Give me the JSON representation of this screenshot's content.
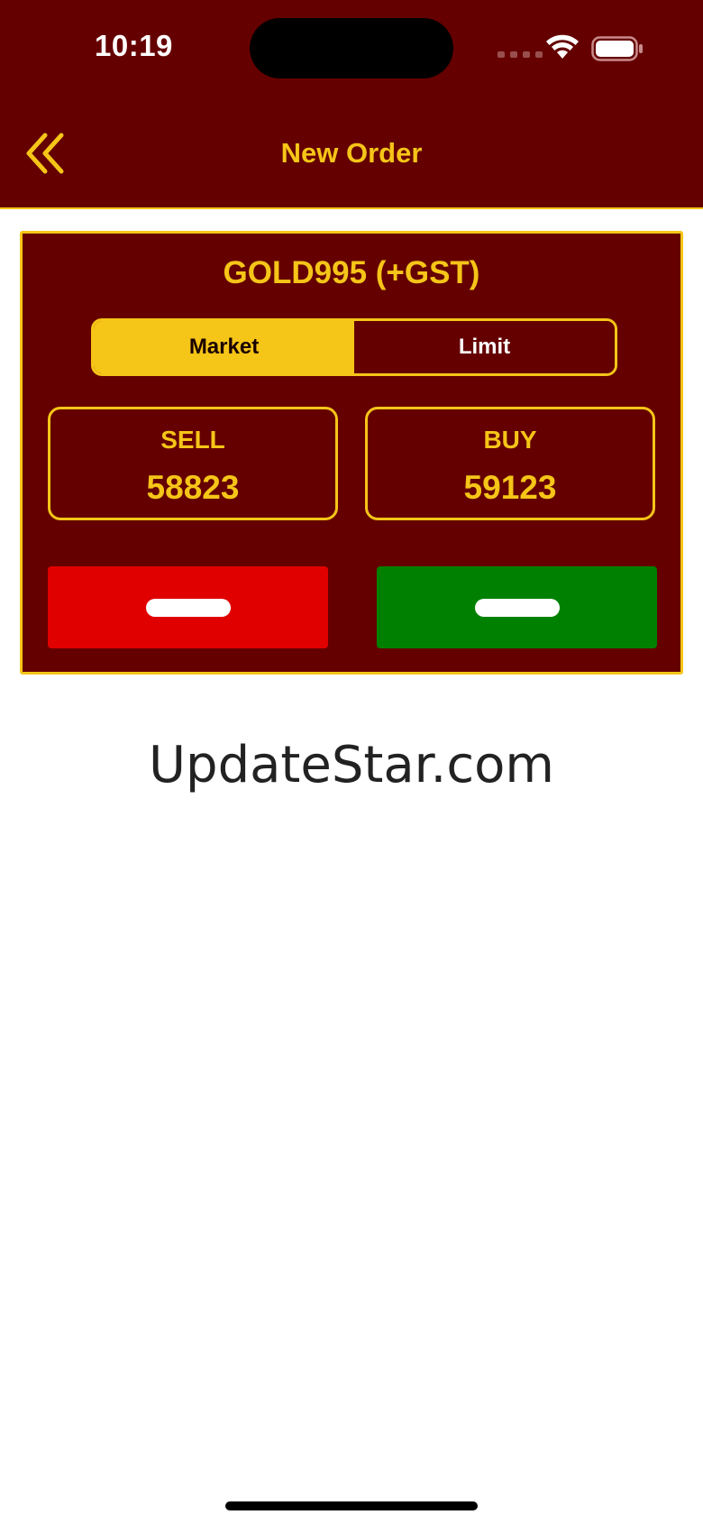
{
  "status_bar": {
    "time": "10:19"
  },
  "header": {
    "title": "New Order",
    "back_icon": "double-chevron-left-icon"
  },
  "order": {
    "symbol": "GOLD995 (+GST)",
    "tabs": [
      {
        "label": "Market",
        "selected": true
      },
      {
        "label": "Limit",
        "selected": false
      }
    ],
    "sell": {
      "label": "SELL",
      "price": "58823"
    },
    "buy": {
      "label": "BUY",
      "price": "59123"
    }
  },
  "watermark": "UpdateStar.com",
  "colors": {
    "primary": "#650000",
    "accent": "#f5c518",
    "sell": "#e00000",
    "buy": "#008000"
  }
}
